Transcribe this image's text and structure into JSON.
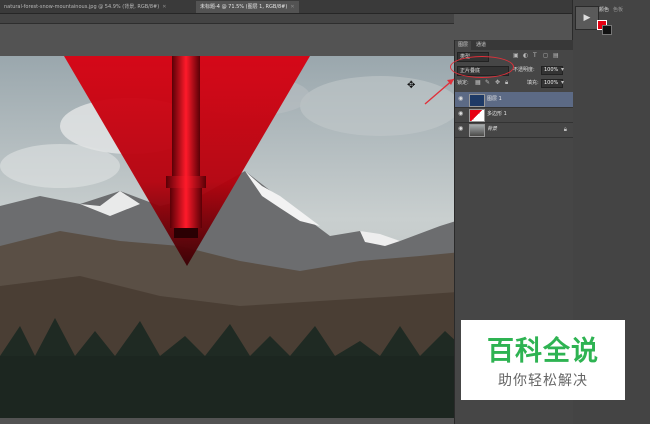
{
  "tabs": [
    {
      "label": "natural-forest-snow-mountainous.jpg @ 54.9% (背景, RGB/8#)",
      "active": false
    },
    {
      "label": "未标题-4 @ 71.5% (图层 1, RGB/8#)",
      "active": true
    }
  ],
  "right_panel": {
    "color_tab": "颜色",
    "swatches_tab": "色板",
    "fg_color": "#e60012",
    "bg_color": "#111111"
  },
  "layers_panel": {
    "tab_layers": "图层",
    "tab_channels": "通道",
    "kind_filter": "类型",
    "blend_mode": "正片叠底",
    "opacity_label": "不透明度:",
    "opacity_value": "100%",
    "lock_label": "锁定:",
    "fill_label": "填充:",
    "fill_value": "100%",
    "layers": [
      {
        "name": "图层 1",
        "selected": true
      },
      {
        "name": "多边形 1",
        "selected": false
      },
      {
        "name": "背景",
        "selected": false
      }
    ]
  },
  "watermark": {
    "main": "百科全说",
    "sub": "助你轻松解决"
  },
  "colors": {
    "accent_red": "#e60012",
    "watermark_green": "#2eb352"
  }
}
